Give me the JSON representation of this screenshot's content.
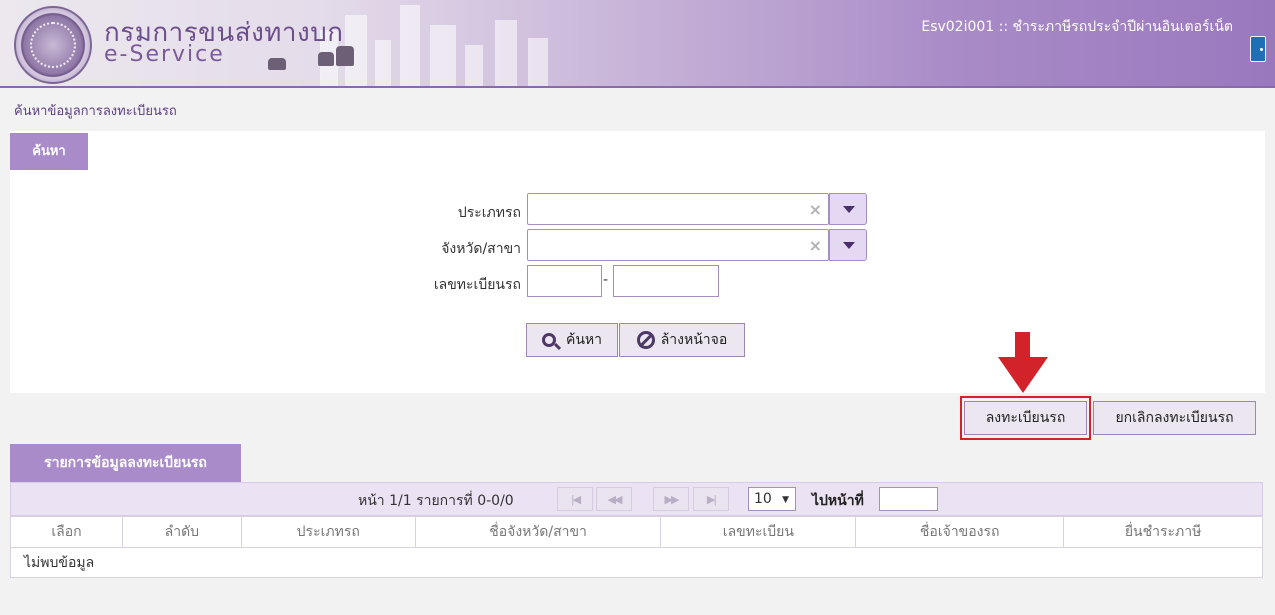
{
  "header": {
    "org_name": "กรมการขนส่งทางบก",
    "service_name": "e-Service",
    "page_code_title": "Esv02i001 :: ชำระภาษีรถประจำปีผ่านอินเตอร์เน็ต",
    "logout_icon": "door-exit-icon"
  },
  "breadcrumb": "ค้นหาข้อมูลการลงทะเบียนรถ",
  "search_panel": {
    "tab_label": "ค้นหา",
    "vehicle_type_label": "ประเภทรถ",
    "vehicle_type_value": "",
    "province_label": "จังหวัด/สาขา",
    "province_value": "",
    "plate_label": "เลขทะเบียนรถ",
    "plate_separator": "-",
    "plate_prefix_value": "",
    "plate_number_value": "",
    "clear_icon": "×",
    "search_button": "ค้นหา",
    "reset_button": "ล้างหน้าจอ"
  },
  "actions": {
    "register_button": "ลงทะเบียนรถ",
    "cancel_register_button": "ยกเลิกลงทะเบียนรถ"
  },
  "results": {
    "tab_label": "รายการข้อมูลลงทะเบียนรถ",
    "pager_text": "หน้า 1/1 รายการที่ 0-0/0",
    "page_size": "10",
    "goto_label": "ไปหน้าที่",
    "goto_value": "",
    "columns": [
      "เลือก",
      "ลำดับ",
      "ประเภทรถ",
      "ชื่อจังหวัด/สาขา",
      "เลขทะเบียน",
      "ชื่อเจ้าของรถ",
      "ยื่นชำระภาษี"
    ],
    "empty_message": "ไม่พบข้อมูล"
  },
  "colors": {
    "accent_purple": "#a98bc9",
    "highlight_red": "#d2222a"
  }
}
